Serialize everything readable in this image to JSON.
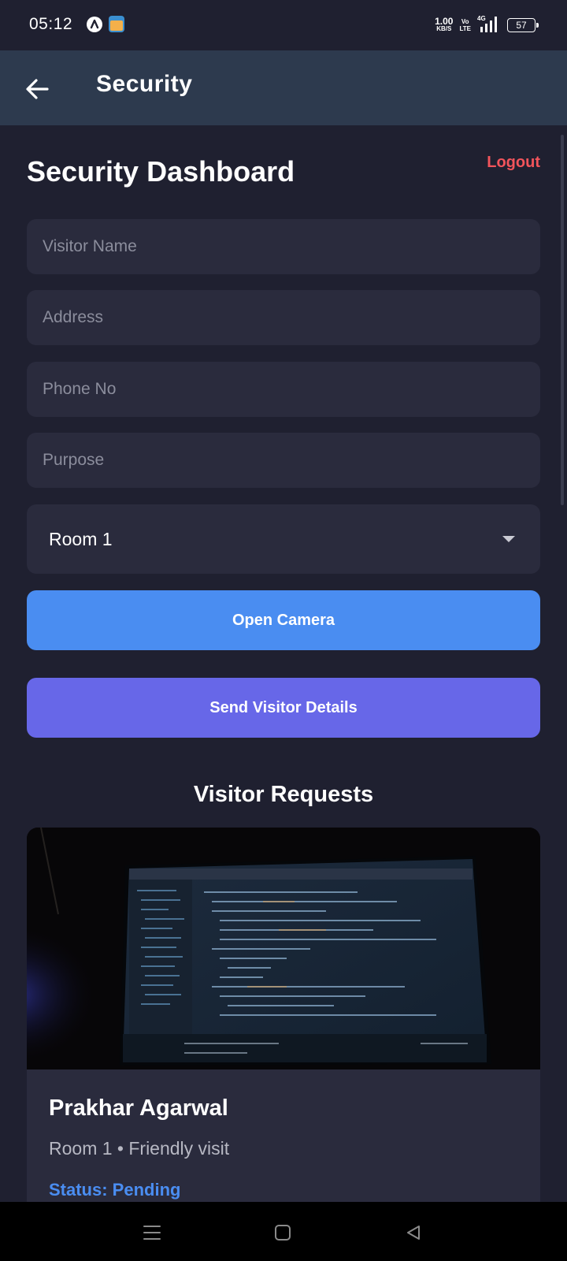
{
  "status_bar": {
    "time": "05:12",
    "net_speed_value": "1.00",
    "net_speed_unit": "KB/S",
    "volte_top": "Vo",
    "volte_bottom": "LTE",
    "network_tag": "4G",
    "battery": "57",
    "icons": [
      "app-a-icon",
      "shopping-bag-icon",
      "signal-icon",
      "battery-icon"
    ]
  },
  "app_bar": {
    "title": "Security",
    "back_icon": "arrow-left-icon"
  },
  "dashboard": {
    "title": "Security Dashboard",
    "logout_label": "Logout"
  },
  "form": {
    "visitor_name": {
      "value": "",
      "placeholder": "Visitor Name"
    },
    "address": {
      "value": "",
      "placeholder": "Address"
    },
    "phone": {
      "value": "",
      "placeholder": "Phone No"
    },
    "purpose": {
      "value": "",
      "placeholder": "Purpose"
    },
    "room_select": {
      "selected": "Room 1"
    },
    "open_camera_label": "Open Camera",
    "send_label": "Send Visitor Details"
  },
  "requests": {
    "title": "Visitor Requests",
    "items": [
      {
        "name": "Prakhar Agarwal",
        "meta": "Room 1 • Friendly visit",
        "status": "Status: Pending"
      }
    ]
  },
  "nav_bar": {
    "icons": [
      "menu-icon",
      "home-square-icon",
      "back-triangle-icon"
    ]
  },
  "colors": {
    "background": "#1f2030",
    "app_bar": "#2d3a4e",
    "field": "#2a2b3d",
    "logout": "#f2545b",
    "camera_button": "#4a8df1",
    "send_button": "#6767e8",
    "status_pending": "#4a8df1"
  }
}
